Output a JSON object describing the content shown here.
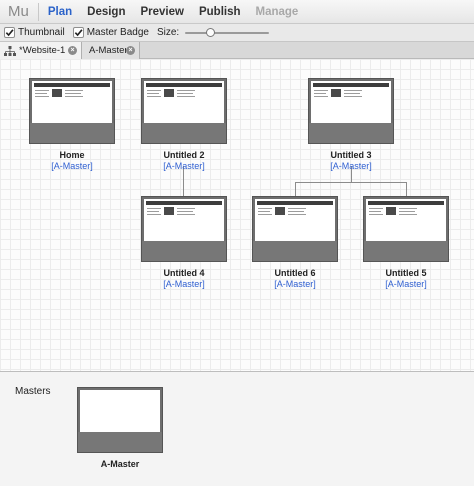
{
  "app": {
    "logo": "Mu",
    "menu": [
      {
        "label": "Plan",
        "state": "active"
      },
      {
        "label": "Design",
        "state": "normal"
      },
      {
        "label": "Preview",
        "state": "normal"
      },
      {
        "label": "Publish",
        "state": "normal"
      },
      {
        "label": "Manage",
        "state": "disabled"
      }
    ]
  },
  "options": {
    "thumbnail_label": "Thumbnail",
    "thumbnail_checked": true,
    "master_badge_label": "Master Badge",
    "master_badge_checked": true,
    "size_label": "Size:",
    "size_level": 0.28
  },
  "tabs": [
    {
      "label": "*Website-1",
      "icon": "sitemap-icon"
    },
    {
      "label": "A-Master",
      "icon": ""
    }
  ],
  "pages": [
    {
      "title": "Home",
      "master": "[A-Master]"
    },
    {
      "title": "Untitled 2",
      "master": "[A-Master]"
    },
    {
      "title": "Untitled 3",
      "master": "[A-Master]"
    },
    {
      "title": "Untitled 4",
      "master": "[A-Master]"
    },
    {
      "title": "Untitled 6",
      "master": "[A-Master]"
    },
    {
      "title": "Untitled 5",
      "master": "[A-Master]"
    }
  ],
  "masters": {
    "title": "Masters",
    "items": [
      {
        "title": "A-Master"
      }
    ]
  },
  "colors": {
    "accent": "#2a62c9",
    "master_link": "#2f5fd0",
    "thumb_frame": "#6e6e6e"
  }
}
